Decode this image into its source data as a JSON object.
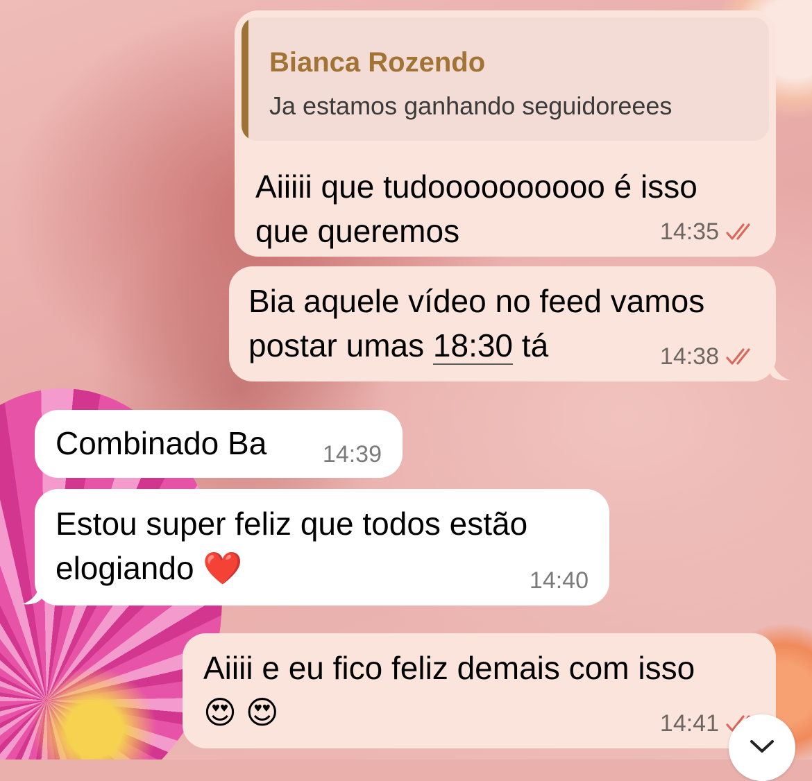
{
  "messages": [
    {
      "direction": "outgoing",
      "reply_to": {
        "author": "Bianca Rozendo",
        "text": "Ja estamos ganhando seguidoreees"
      },
      "text": "Aiiiii que tudoooooooooo é isso\nque queremos",
      "time": "14:35",
      "status": "read"
    },
    {
      "direction": "outgoing",
      "text_before": "Bia aquele vídeo no feed vamos\npostar umas ",
      "text_link": "18:30",
      "text_after": " tá",
      "time": "14:38",
      "status": "read"
    },
    {
      "direction": "incoming",
      "text": "Combinado Ba",
      "time": "14:39"
    },
    {
      "direction": "incoming",
      "text": "Estou super feliz que todos estão\nelogiando ❤️",
      "time": "14:40"
    },
    {
      "direction": "outgoing",
      "text": "Aiiii e eu fico feliz demais com isso\n😍 😍",
      "time": "14:41",
      "status": "read"
    }
  ],
  "icons": {
    "read_receipt": "double-check-icon",
    "scroll_down": "chevron-down-icon"
  },
  "colors": {
    "outgoing_bubble": "#fbe4dc",
    "incoming_bubble": "#ffffff",
    "quote_accent": "#9c7334",
    "read_check": "#d9695a"
  }
}
